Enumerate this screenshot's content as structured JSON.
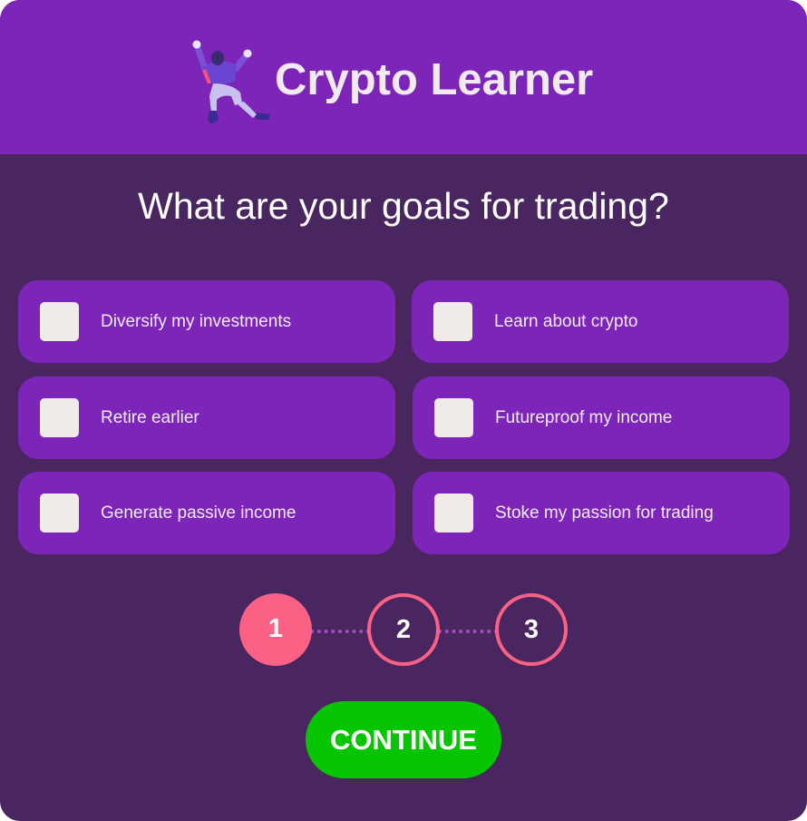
{
  "header": {
    "title": "Crypto Learner",
    "logo_icon": "jumping-person-illustration",
    "background": "#7d25b8"
  },
  "question": "What are your goals for trading?",
  "options": [
    {
      "label": "Diversify my investments",
      "checked": false
    },
    {
      "label": "Learn about crypto",
      "checked": false
    },
    {
      "label": "Retire earlier",
      "checked": false
    },
    {
      "label": "Futureproof my income",
      "checked": false
    },
    {
      "label": "Generate passive income",
      "checked": false
    },
    {
      "label": "Stoke my passion for trading",
      "checked": false
    }
  ],
  "steps": [
    {
      "label": "1",
      "state": "active"
    },
    {
      "label": "2",
      "state": "pending"
    },
    {
      "label": "3",
      "state": "pending"
    }
  ],
  "continue_label": "CONTINUE",
  "colors": {
    "page_background": "#4a2660",
    "option_background": "#7d25b8",
    "step_accent": "#fb6185",
    "continue_button": "#07c500"
  }
}
